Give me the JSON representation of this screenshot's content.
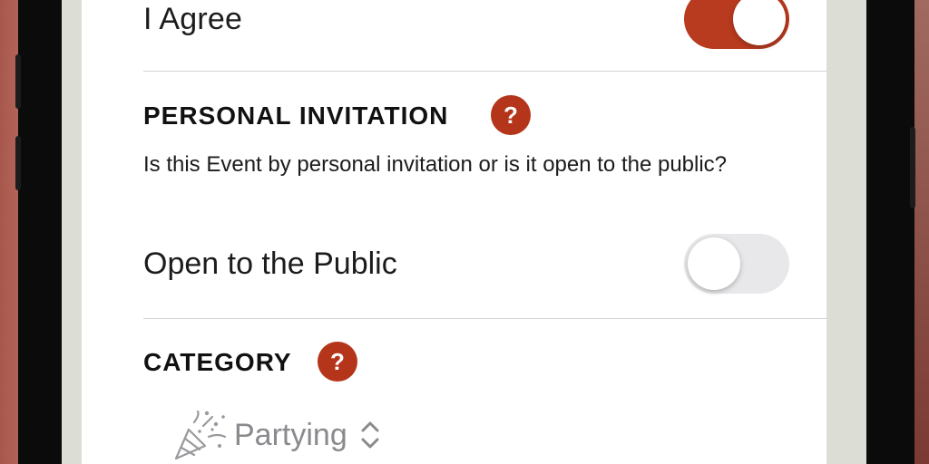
{
  "agree": {
    "label": "I Agree",
    "toggle_on": true
  },
  "personal_invitation": {
    "title": "PERSONAL INVITATION",
    "help": "?",
    "description": "Is this Event by personal invitation or is it open to the public?",
    "public_label": "Open to the Public",
    "toggle_on": false
  },
  "category": {
    "title": "CATEGORY",
    "help": "?",
    "value": "Partying",
    "icon": "party-popper-icon"
  },
  "colors": {
    "accent": "#b5351b",
    "switch_on": "#b83a1f",
    "switch_off": "#e8e8ea"
  }
}
